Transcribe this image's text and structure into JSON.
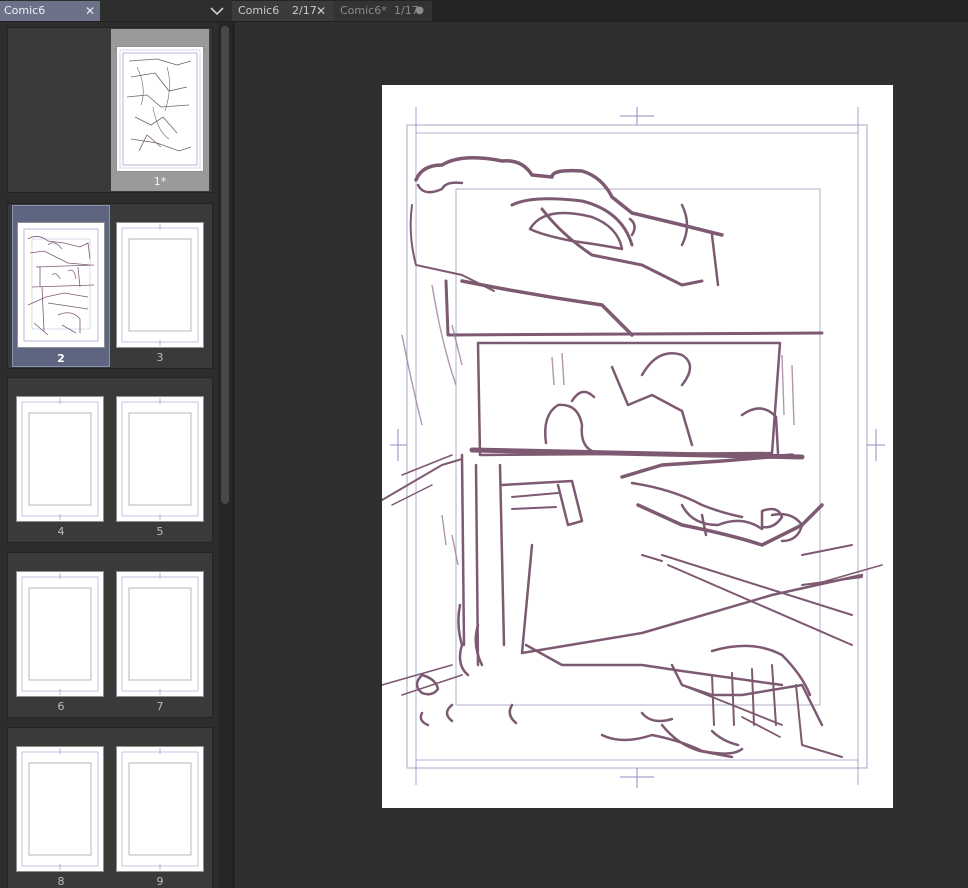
{
  "page_manager": {
    "tab_title": "Comic6",
    "close_glyph": "✕",
    "menu_icon": "chevron-down-icon",
    "pages": [
      {
        "label": "1*",
        "state": "selected-light"
      },
      {
        "label": "2",
        "state": "selected-active"
      },
      {
        "label": "3",
        "state": "normal"
      },
      {
        "label": "4",
        "state": "normal"
      },
      {
        "label": "5",
        "state": "normal"
      },
      {
        "label": "6",
        "state": "normal"
      },
      {
        "label": "7",
        "state": "normal"
      },
      {
        "label": "8",
        "state": "normal"
      },
      {
        "label": "9",
        "state": "normal"
      }
    ]
  },
  "document_tabs": [
    {
      "name": "Comic6",
      "pages": "2/17",
      "close_glyph": "✕",
      "active": true
    },
    {
      "name": "Comic6*",
      "pages": "1/17",
      "close_glyph": "●",
      "active": false
    }
  ],
  "colors": {
    "accent_tab": "#6c7388",
    "page_selected_blue": "#5d6580",
    "sketch_stroke": "#7d5a72",
    "frame_line": "#8c8cc4"
  }
}
